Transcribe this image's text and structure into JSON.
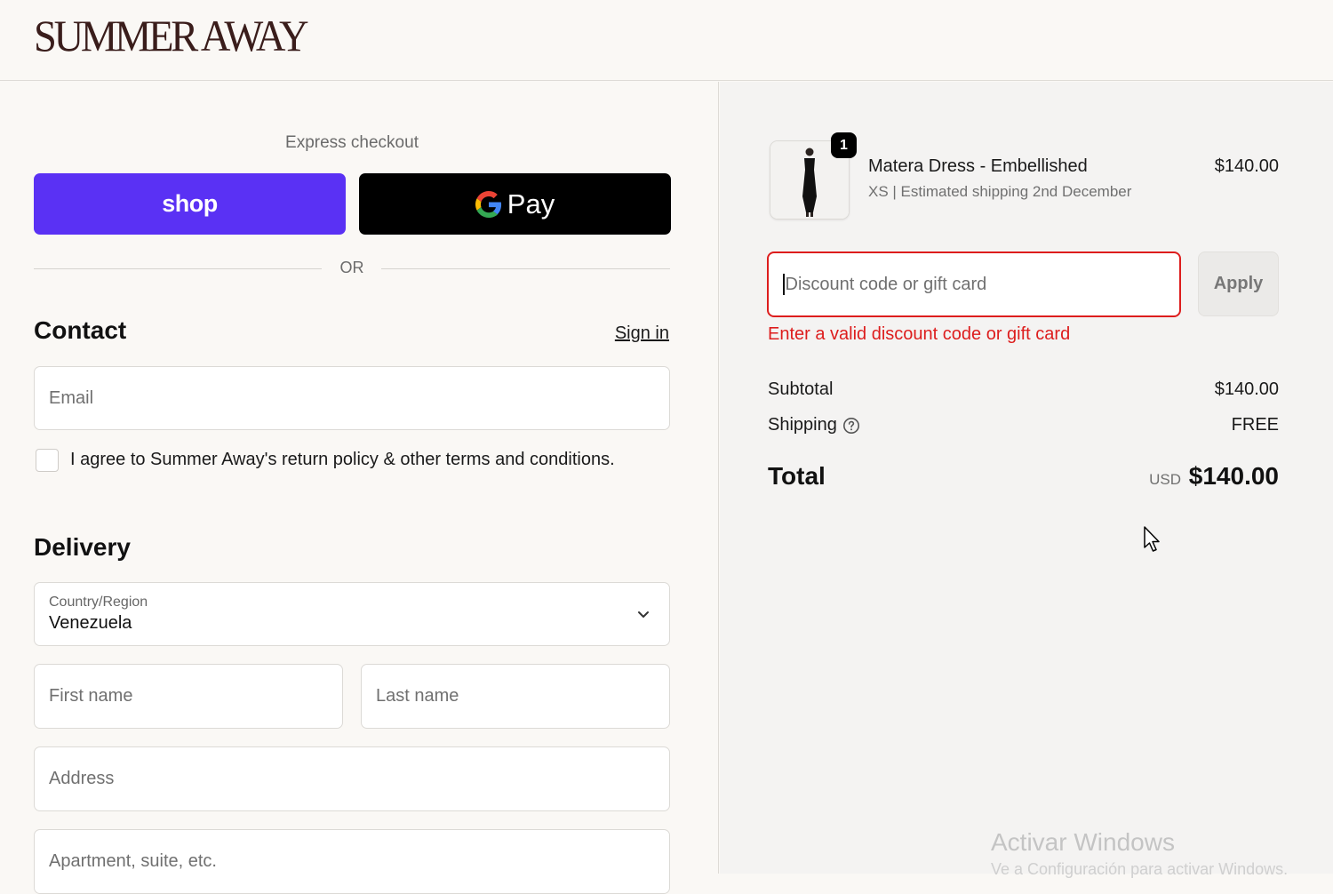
{
  "brand": {
    "logo_text": "SUMMER AWAY",
    "logo_color": "#3a1d1b"
  },
  "express": {
    "label": "Express checkout",
    "shop_label": "shop",
    "gpay_label": "Pay",
    "shop_color": "#5a31f4",
    "or_label": "OR"
  },
  "contact": {
    "title": "Contact",
    "sign_in": "Sign in",
    "email_placeholder": "Email",
    "agree_text": "I agree to Summer Away's return policy & other terms and conditions."
  },
  "delivery": {
    "title": "Delivery",
    "country_label": "Country/Region",
    "country_value": "Venezuela",
    "first_name_placeholder": "First name",
    "last_name_placeholder": "Last name",
    "address_placeholder": "Address",
    "apartment_placeholder": "Apartment, suite, etc."
  },
  "summary": {
    "item": {
      "quantity": "1",
      "name": "Matera Dress - Embellished",
      "details": "XS | Estimated shipping 2nd December",
      "price": "$140.00"
    },
    "discount": {
      "placeholder": "Discount code or gift card",
      "apply_label": "Apply",
      "error": "Enter a valid discount code or gift card",
      "error_color": "#dd1d1d"
    },
    "subtotal_label": "Subtotal",
    "subtotal_value": "$140.00",
    "shipping_label": "Shipping",
    "shipping_value": "FREE",
    "total_label": "Total",
    "total_currency": "USD",
    "total_value": "$140.00"
  },
  "os_watermark": {
    "title": "Activar Windows",
    "subtitle": "Ve a Configuración para activar Windows."
  }
}
